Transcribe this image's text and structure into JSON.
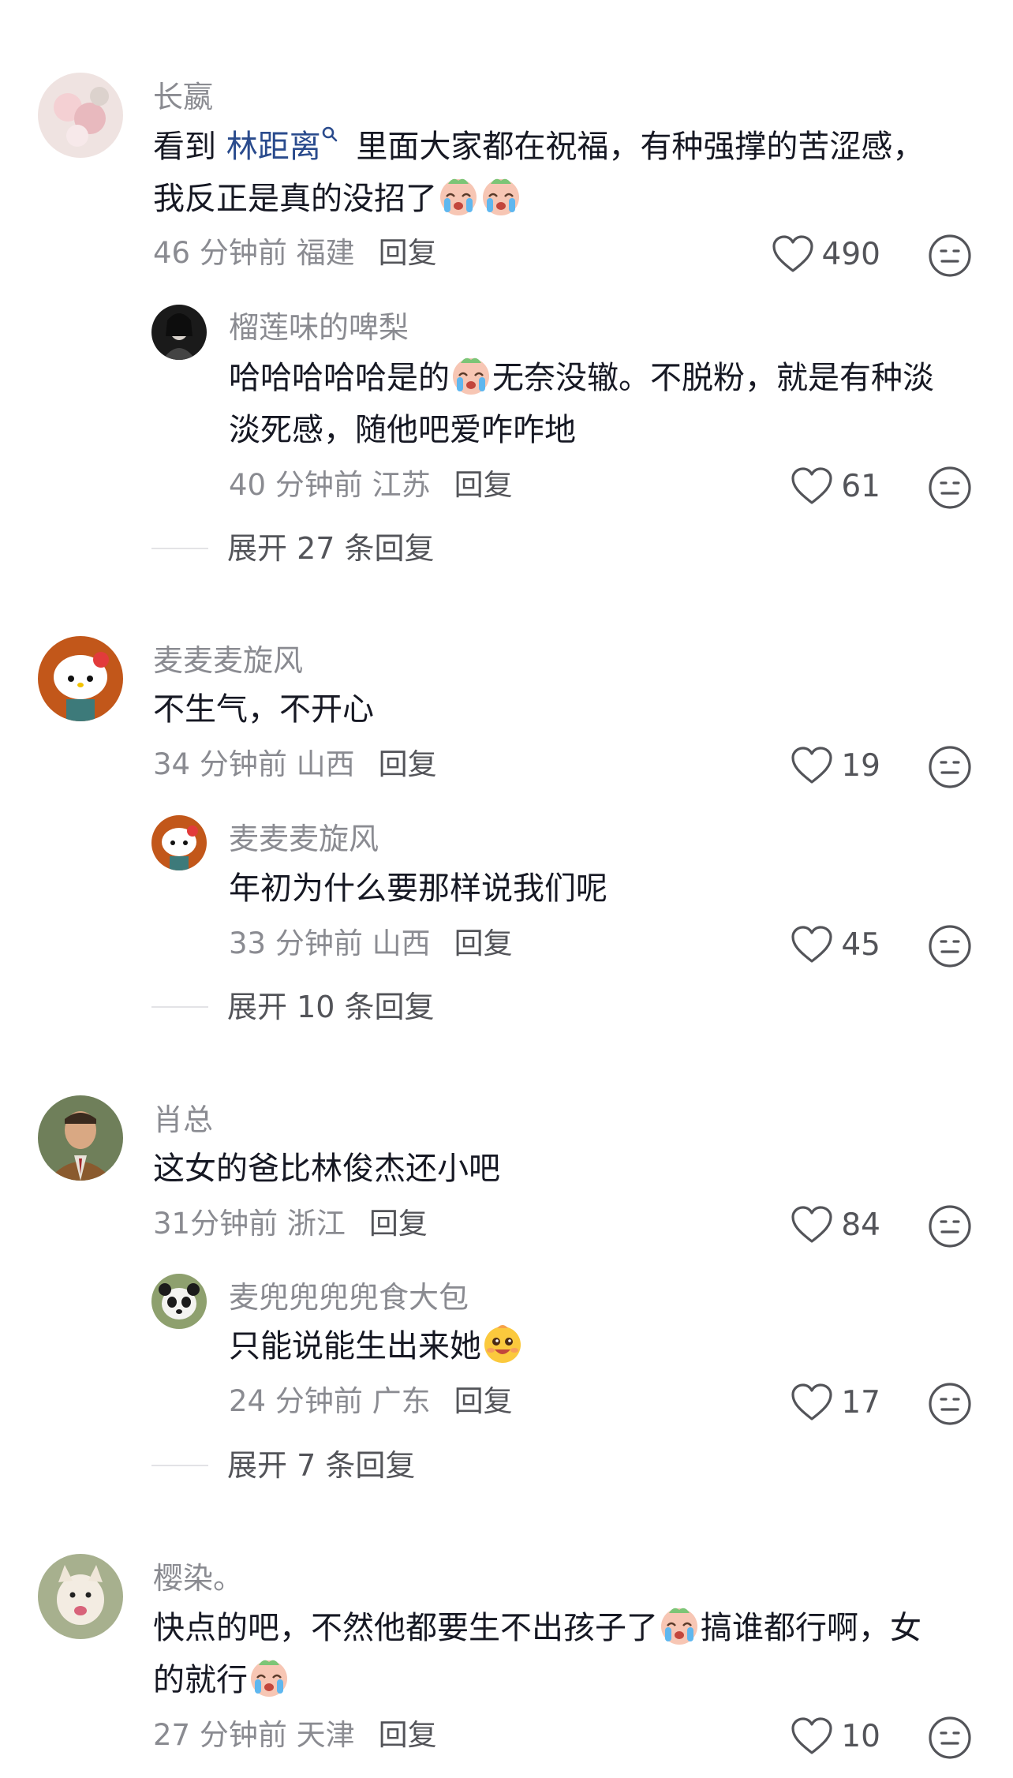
{
  "comments": [
    {
      "user": "长嬴",
      "text_before_link": "看到 ",
      "link": "林距离",
      "text_after_link": " 里面大家都在祝福，有种强撑的苦涩感，",
      "text_line2": "我反正是真的没招了",
      "time": "46 分钟前",
      "location": "福建",
      "reply_label": "回复",
      "likes": "490",
      "replies": [
        {
          "user": "榴莲味的啤梨",
          "text_a": "哈哈哈哈哈是的",
          "text_b": "无奈没辙。不脱粉，就是有种淡",
          "text_line2": "淡死感，随他吧爱咋咋地",
          "time": "40 分钟前",
          "location": "江苏",
          "reply_label": "回复",
          "likes": "61"
        }
      ],
      "expand_label": "展开 27 条回复"
    },
    {
      "user": "麦麦麦旋风",
      "text": "不生气，不开心",
      "time": "34 分钟前",
      "location": "山西",
      "reply_label": "回复",
      "likes": "19",
      "replies": [
        {
          "user": "麦麦麦旋风",
          "text": "年初为什么要那样说我们呢",
          "time": "33 分钟前",
          "location": "山西",
          "reply_label": "回复",
          "likes": "45"
        }
      ],
      "expand_label": "展开 10 条回复"
    },
    {
      "user": "肖总",
      "text": "这女的爸比林俊杰还小吧",
      "time": "31分钟前",
      "location": "浙江",
      "reply_label": "回复",
      "likes": "84",
      "replies": [
        {
          "user": "麦兜兜兜兜食大包",
          "text": "只能说能生出来她",
          "time": "24 分钟前",
          "location": "广东",
          "reply_label": "回复",
          "likes": "17"
        }
      ],
      "expand_label": "展开 7 条回复"
    },
    {
      "user": "樱染。",
      "text_a": "快点的吧，不然他都要生不出孩子了",
      "text_b": "搞谁都行啊，女",
      "text_line2": "的就行",
      "time": "27 分钟前",
      "location": "天津",
      "reply_label": "回复",
      "likes": "10"
    }
  ],
  "icons": {
    "like": "heart-outline-icon",
    "more": "neutral-face-icon",
    "search": "search-icon",
    "emoji_crying": "crying-emoji",
    "emoji_grin": "grinning-sweat-emoji"
  },
  "colors": {
    "text": "#161823",
    "secondary": "#8a8b91",
    "link": "#2a4b8d",
    "action": "#535459"
  }
}
